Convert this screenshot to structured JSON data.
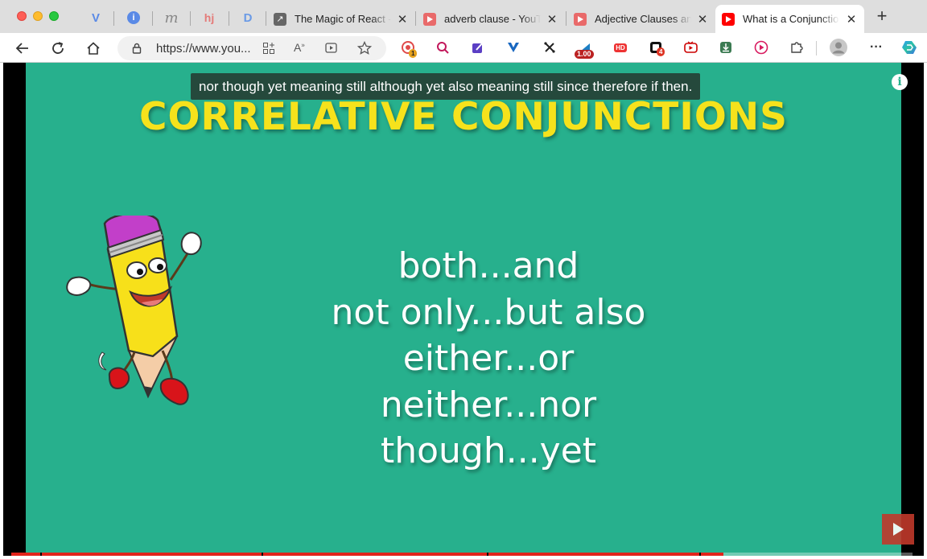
{
  "browser": {
    "pinned_tabs": [
      {
        "icon": "vuetify-icon",
        "glyph": "V",
        "color": "#5a8ae6"
      },
      {
        "icon": "info-icon",
        "glyph": "i",
        "color": "#5a8ae6"
      },
      {
        "icon": "m-logo-icon",
        "glyph": "m",
        "color": "#888888"
      },
      {
        "icon": "hj-logo-icon",
        "glyph": "hj",
        "color": "#e47b79"
      },
      {
        "icon": "d-logo-icon",
        "glyph": "D",
        "color": "#6a9ae6"
      }
    ],
    "tabs": [
      {
        "title": "The Magic of React - Under the Hood",
        "close": "✕"
      },
      {
        "title": "adverb clause - YouTube",
        "close": "✕"
      },
      {
        "title": "Adjective Clauses and Relative Pronouns",
        "close": "✕"
      },
      {
        "title": "What is a Conjunction",
        "close": "✕"
      }
    ],
    "new_tab": "+",
    "url": "https://www.you...",
    "extensions": {
      "badge_1": "1",
      "zoom_level": "1.00",
      "hd_label": "HD",
      "badge_4": "4",
      "menu": "···"
    },
    "colors": {
      "accent_red": "#e2231a",
      "slide_green": "#27b08d",
      "title_yellow": "#f6e21c"
    }
  },
  "video": {
    "caption": "nor though yet meaning still although yet  also meaning still since therefore if then.",
    "title": "CORRELATIVE CONJUNCTIONS",
    "pairs": [
      "both...and",
      "not only...but also",
      "either...or",
      "neither...nor",
      "though...yet"
    ],
    "info_glyph": "i",
    "progress": 0.79
  }
}
